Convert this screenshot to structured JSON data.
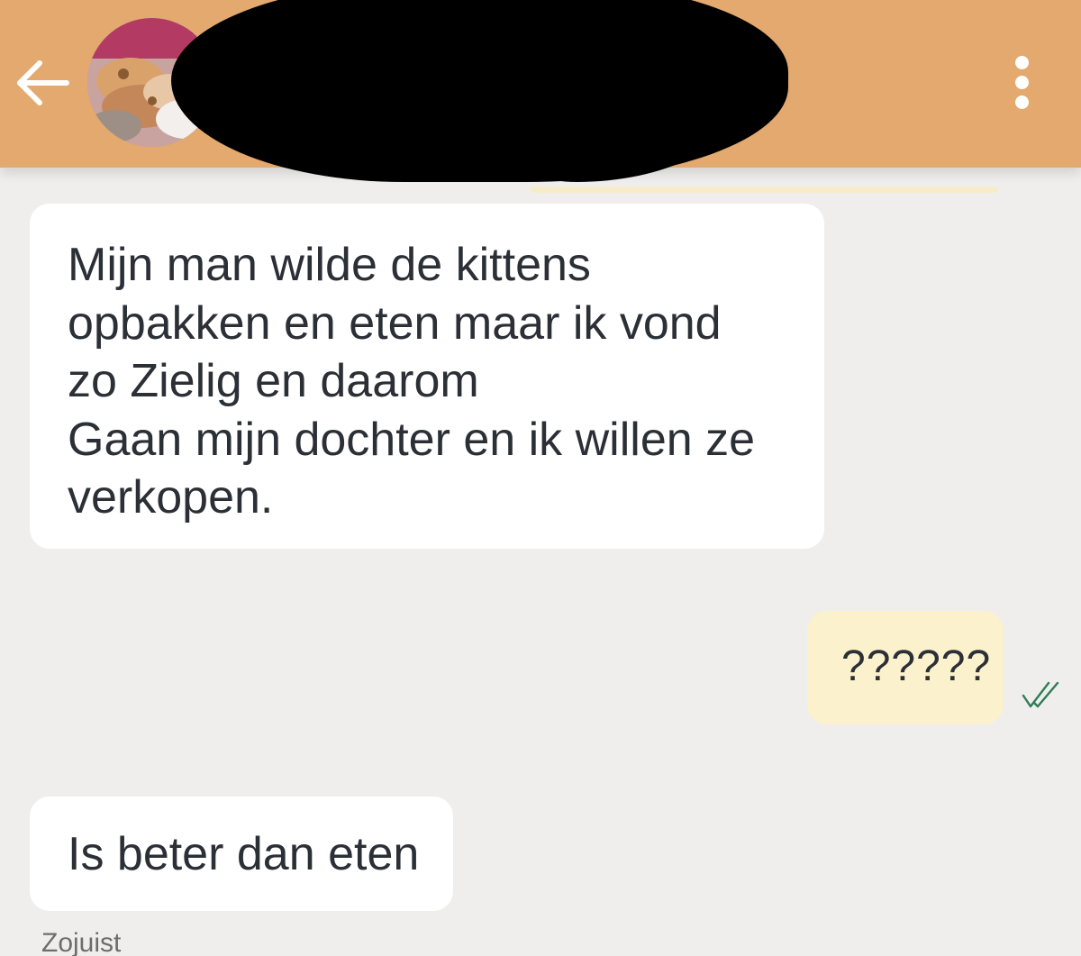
{
  "header": {
    "background_color": "#e3a96e",
    "back_icon": "arrow-left-icon",
    "menu_icon": "more-vertical-icon",
    "avatar_description_icon": "contact-avatar"
  },
  "messages": [
    {
      "direction": "incoming",
      "text": "Mijn man wilde de kittens\nopbakken en eten maar ik vond\nzo Zielig en daarom\nGaan mijn dochter en ik willen ze\nverkopen."
    },
    {
      "direction": "outgoing",
      "text": "??????",
      "status_icon": "double-check-icon"
    },
    {
      "direction": "incoming",
      "text": "Is beter dan eten"
    }
  ],
  "timestamp": "Zojuist",
  "colors": {
    "chat_background": "#efeeec",
    "incoming_bubble": "#ffffff",
    "outgoing_bubble": "#fbf1cc",
    "check_color": "#2e7d55"
  }
}
